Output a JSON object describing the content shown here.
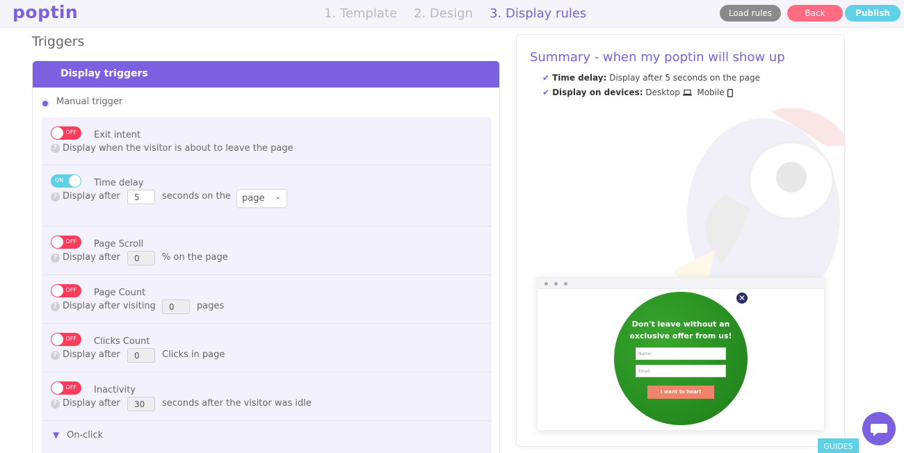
{
  "app": {
    "logo": "poptin"
  },
  "steps": [
    {
      "label": "1. Template",
      "active": false
    },
    {
      "label": "2. Design",
      "active": false
    },
    {
      "label": "3. Display rules",
      "active": true
    }
  ],
  "header_buttons": {
    "load_rules": "Load rules",
    "back": "Back",
    "publish": "Publish"
  },
  "triggers": {
    "title": "Triggers",
    "panel_title": "Display triggers",
    "manual_label": "Manual trigger",
    "rows": {
      "exit_intent": {
        "state": "OFF",
        "title": "Exit intent",
        "desc": "Display when the visitor is about to leave the page"
      },
      "time_delay": {
        "state": "ON",
        "title": "Time delay",
        "prefix": "Display after",
        "value": "5",
        "suffix": "seconds on the",
        "select": "page"
      },
      "page_scroll": {
        "state": "OFF",
        "title": "Page Scroll",
        "prefix": "Display after",
        "value": "0",
        "suffix": "% on the page"
      },
      "page_count": {
        "state": "OFF",
        "title": "Page Count",
        "prefix": "Display after visiting",
        "value": "0",
        "suffix": "pages"
      },
      "clicks_count": {
        "state": "OFF",
        "title": "Clicks Count",
        "prefix": "Display after",
        "value": "0",
        "suffix": "Clicks in page"
      },
      "inactivity": {
        "state": "OFF",
        "title": "Inactivity",
        "prefix": "Display after",
        "value": "30",
        "suffix": "seconds after the visitor was idle"
      }
    },
    "on_click": "On-click"
  },
  "summary": {
    "title": "Summary - when my poptin will show up",
    "time_delay_label": "Time delay:",
    "time_delay_value": "Display after 5 seconds on the page",
    "devices_label": "Display on devices:",
    "device_desktop": "Desktop",
    "device_mobile": "Mobile"
  },
  "preview": {
    "title": "Don't leave without an exclusive offer from us!",
    "name_placeholder": "Name:",
    "email_placeholder": "Email:",
    "button": "I want to hear!"
  },
  "guides": "GUIDES",
  "colors": {
    "accent": "#7b61e0",
    "off": "#ff3b5c",
    "on": "#5fd0e6",
    "popup_green": "#2b9424",
    "popup_button": "#f0846a"
  }
}
